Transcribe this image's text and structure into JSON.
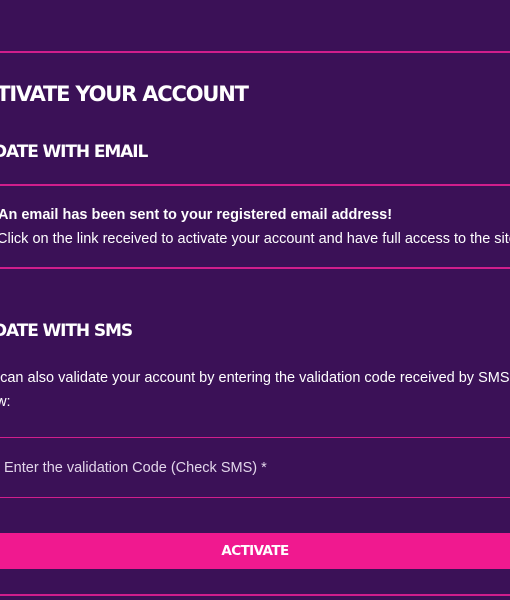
{
  "page": {
    "title": "CTIVATE YOUR ACCOUNT"
  },
  "email_section": {
    "heading": "LIDATE WITH EMAIL",
    "line1": "An email has been sent to your registered email address!",
    "line2": "Click on the link received to activate your account and have full access to the site."
  },
  "sms_section": {
    "heading": "LIDATE WITH SMS",
    "description": "u can also validate your account by entering the validation code received by SMS ow:",
    "code_placeholder": "Enter the validation Code (Check SMS) *",
    "code_value": ""
  },
  "actions": {
    "activate_label": "ACTIVATE"
  },
  "colors": {
    "background": "#3b1157",
    "accent": "#f0198f",
    "divider": "#d11e8c"
  }
}
